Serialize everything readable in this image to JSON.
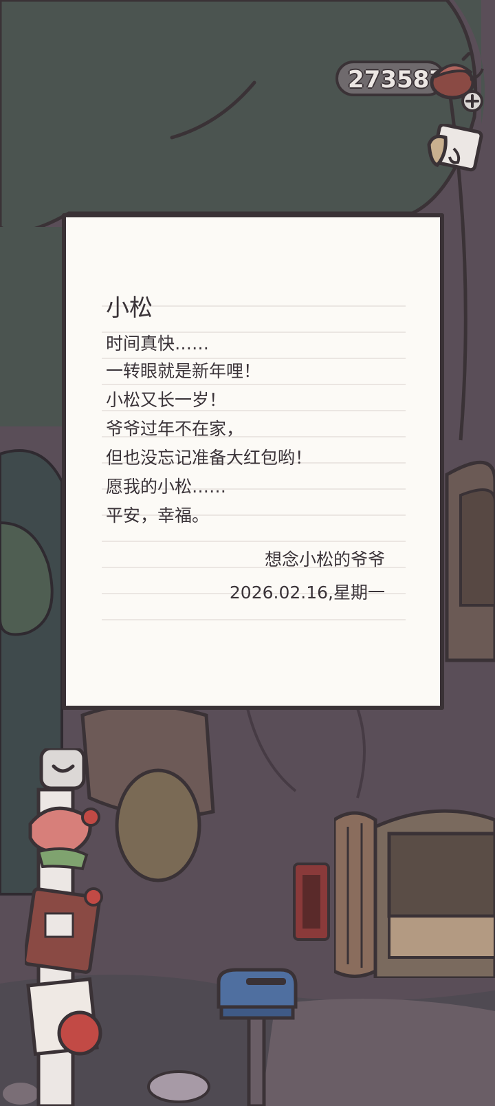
{
  "currency": {
    "value": "273587",
    "icon": "acorn-icon",
    "add_icon": "plus-icon"
  },
  "letter": {
    "greeting": "小松",
    "lines": [
      "时间真快……",
      "一转眼就是新年哩！",
      "小松又长一岁！",
      "爷爷过年不在家，",
      "但也没忘记准备大红包哟！",
      "愿我的小松……",
      "平安，幸福。"
    ],
    "signature": "想念小松的爷爷",
    "date": "2026.02.16,星期一"
  },
  "scene": {
    "notebook_icon": "notebook-icon",
    "mailbox_icon": "mailbox-icon",
    "letter_shortcut_icon": "letter-icon",
    "door_icon": "door-icon"
  },
  "colors": {
    "outline": "#3a3236",
    "paper": "#fcfaf6",
    "tree_canopy": "#4b5450",
    "trunk": "#5a4e58",
    "mailbox": "#4f6fa0"
  }
}
